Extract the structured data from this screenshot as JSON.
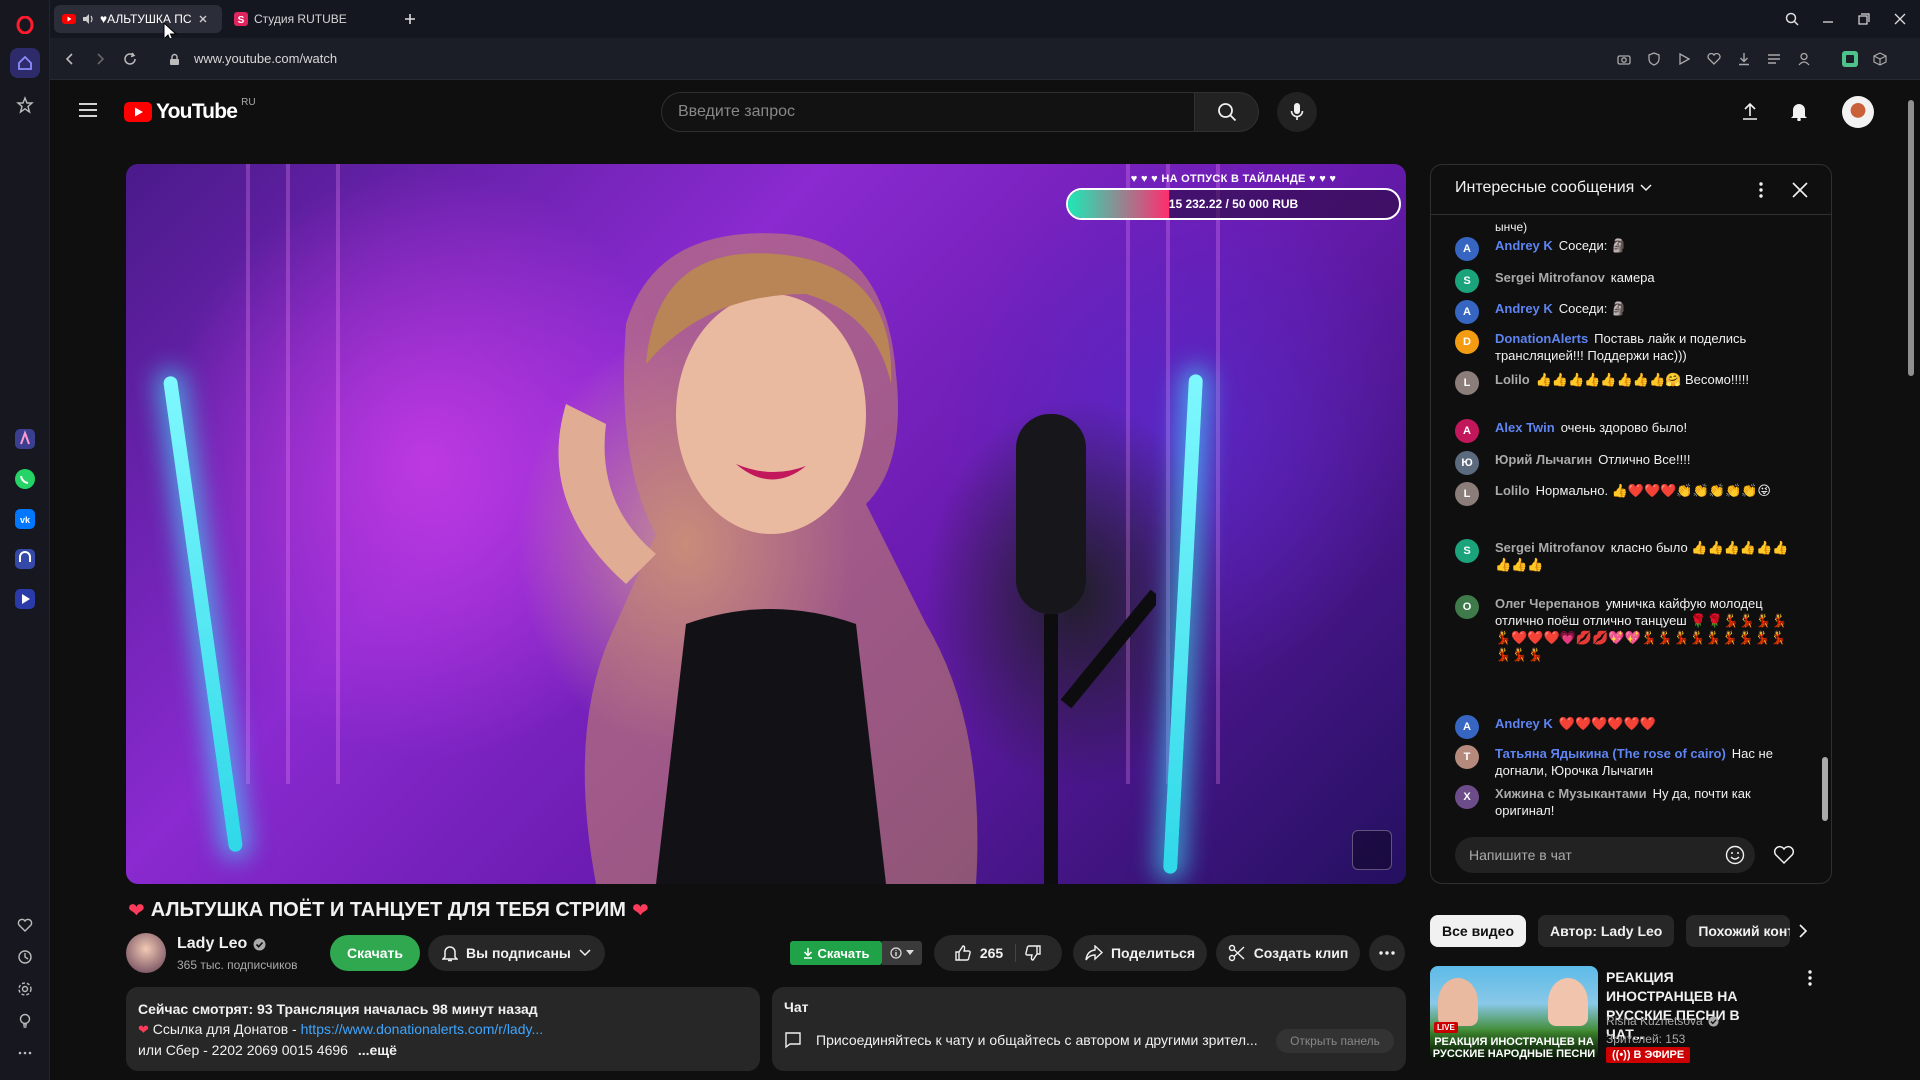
{
  "browser": {
    "tabs": [
      {
        "label": "♥АЛЬТУШКА ПС"
      },
      {
        "label": "Студия RUTUBE"
      }
    ],
    "url": "www.youtube.com/watch"
  },
  "youtube": {
    "logo_text": "YouTube",
    "logo_region": "RU",
    "search_placeholder": "Введите запрос"
  },
  "video": {
    "goal_title": "♥ ♥ ♥ НА ОТПУСК В ТАЙЛАНДЕ ♥ ♥ ♥",
    "goal_text": "15 232.22 / 50 000 RUB",
    "goal_progress": 0.3046,
    "title": "АЛЬТУШКА ПОЁТ И ТАНЦУЕТ ДЛЯ ТЕБЯ СТРИМ",
    "channel_name": "Lady Leo",
    "subscribers": "365 тыс. подписчиков",
    "download_label": "Скачать",
    "subscribed_label": "Вы подписаны",
    "download_small_label": "Скачать",
    "likes": "265",
    "share_label": "Поделиться",
    "clip_label": "Создать клип"
  },
  "description": {
    "line1": "Сейчас смотрят: 93  Трансляция началась 98 минут назад",
    "line2_prefix": "Ссылка для Донатов - ",
    "line2_link": "https://www.donationalerts.com/r/lady...",
    "line3": "или  Сбер - 2202 2069 0015 4696",
    "more": "...ещё"
  },
  "chat_teaser": {
    "title": "Чат",
    "text": "Присоединяйтесь к чату и общайтесь с автором и другими зрител...",
    "open_panel": "Открыть панель"
  },
  "live_chat": {
    "title": "Интересные сообщения",
    "partial_top": "ынче)",
    "messages": [
      {
        "author": "Andrey K",
        "text": "Соседи: 🗿"
      },
      {
        "author": "Sergei Mitrofanov",
        "text": "камера"
      },
      {
        "author": "Andrey K",
        "text": "Соседи: 🗿"
      },
      {
        "author": "DonationAlerts",
        "text": "Поставь лайк и поделись трансляцией!!! Поддержи нас)))"
      },
      {
        "author": "Lolilo",
        "text": "👍👍👍👍👍👍👍👍🤗 Весомо!!!!!"
      },
      {
        "author": "Alex Twin",
        "text": "очень здорово было!"
      },
      {
        "author": "Юрий Лычагин",
        "text": "Отлично Все!!!!"
      },
      {
        "author": "Lolilo",
        "text": "Нормально. 👍❤️❤️❤️👏👏👏👏👏😜"
      },
      {
        "author": "Sergei Mitrofanov",
        "text": "класно было 👍👍👍👍👍👍👍👍👍"
      },
      {
        "author": "Олег Черепанов",
        "text": "умничка кайфую молодец отлично поёш отлично танцуеш 🌹🌹💃💃💃💃💃❤️❤️❤️💗💋💋💖💖💃💃💃💃💃💃💃💃💃💃💃💃"
      },
      {
        "author": "Andrey K",
        "text": "❤️❤️❤️❤️❤️❤️"
      },
      {
        "author": "Татьяна Ядыкина (The rose of cairo)",
        "text": "Нас не догнали, Юрочка Лычагин"
      },
      {
        "author": "Хижина с Музыкантами",
        "text": "Ну да, почти как оригинал!"
      }
    ],
    "input_placeholder": "Напишите в чат"
  },
  "recommendations": {
    "chips": [
      "Все видео",
      "Автор: Lady Leo",
      "Похожий конте"
    ],
    "items": [
      {
        "title": "РЕАКЦИЯ ИНОСТРАНЦЕВ НА РУССКИЕ ПЕСНИ В ЧАТ...",
        "thumb_caption": "РЕАКЦИЯ ИНОСТРАНЦЕВ НА РУССКИЕ НАРОДНЫЕ ПЕСНИ",
        "channel": "Risha Kuznetsova",
        "viewers": "Зрителей: 153",
        "live": "В ЭФИРЕ"
      }
    ]
  },
  "colors": {
    "yt_red": "#ff0000",
    "accent_green": "#2fa84f",
    "link_blue": "#3ea6ff",
    "mod_blue": "#5e84f1",
    "opera_red": "#ff1b2d"
  }
}
